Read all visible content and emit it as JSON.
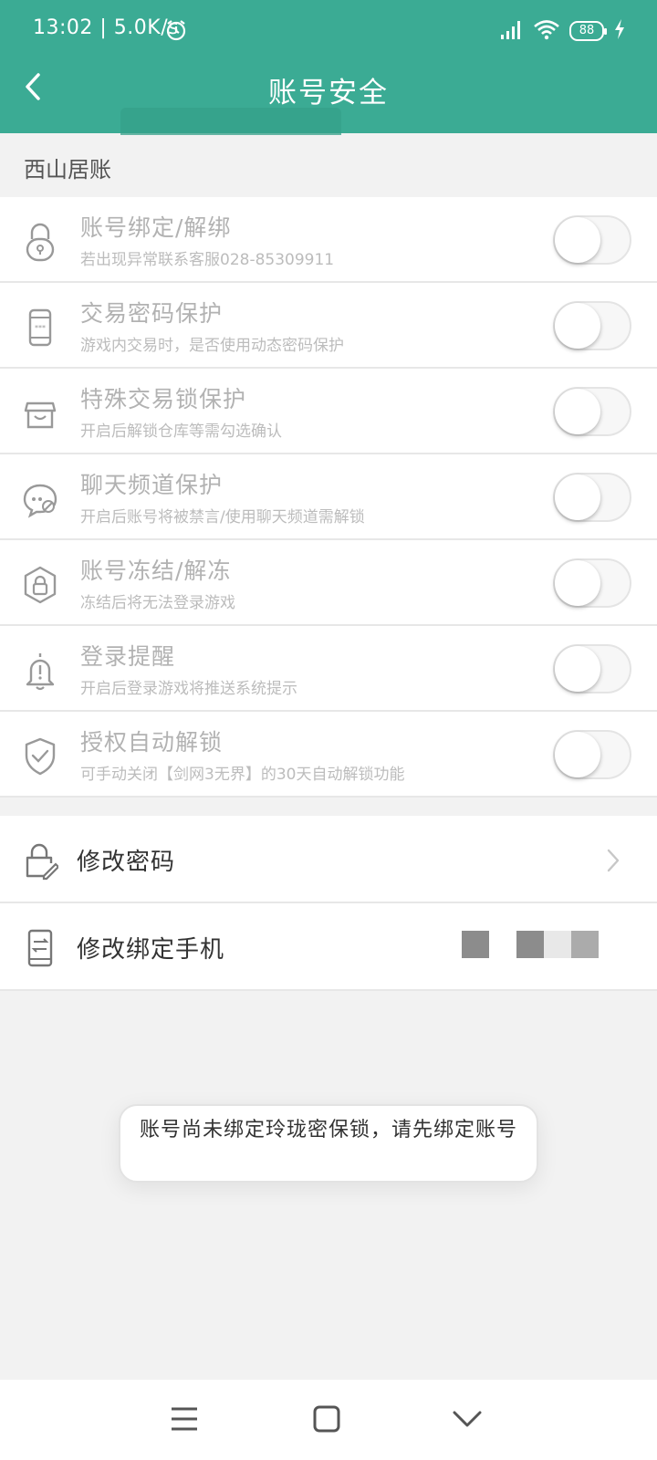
{
  "status_bar": {
    "time": "13:02 | 5.0K/s",
    "battery": "88"
  },
  "header": {
    "title": "账号安全"
  },
  "section": {
    "label": "西山居账"
  },
  "security_items": [
    {
      "label": "账号绑定/解绑",
      "description": "若出现异常联系客服028-85309911",
      "icon": "lock-icon"
    },
    {
      "label": "交易密码保护",
      "description": "游戏内交易时，是否使用动态密码保护",
      "icon": "phone-password-icon"
    },
    {
      "label": "特殊交易锁保护",
      "description": "开启后解锁仓库等需勾选确认",
      "icon": "store-icon"
    },
    {
      "label": "聊天频道保护",
      "description": "开启后账号将被禁言/使用聊天频道需解锁",
      "icon": "chat-lock-icon"
    },
    {
      "label": "账号冻结/解冻",
      "description": "冻结后将无法登录游戏",
      "icon": "hex-lock-icon"
    },
    {
      "label": "登录提醒",
      "description": "开启后登录游戏将推送系统提示",
      "icon": "bell-icon"
    },
    {
      "label": "授权自动解锁",
      "description": "可手动关闭【剑网3无界】的30天自动解锁功能",
      "icon": "shield-check-icon"
    }
  ],
  "toggle_states": [
    false,
    false,
    false,
    false,
    false,
    false,
    false
  ],
  "actions": {
    "change_password": "修改密码",
    "change_phone": "修改绑定手机"
  },
  "toast": {
    "message": "账号尚未绑定玲珑密保锁，请先绑定账号"
  },
  "colors": {
    "header_green": "#3bab94",
    "background": "#f2f2f2"
  }
}
